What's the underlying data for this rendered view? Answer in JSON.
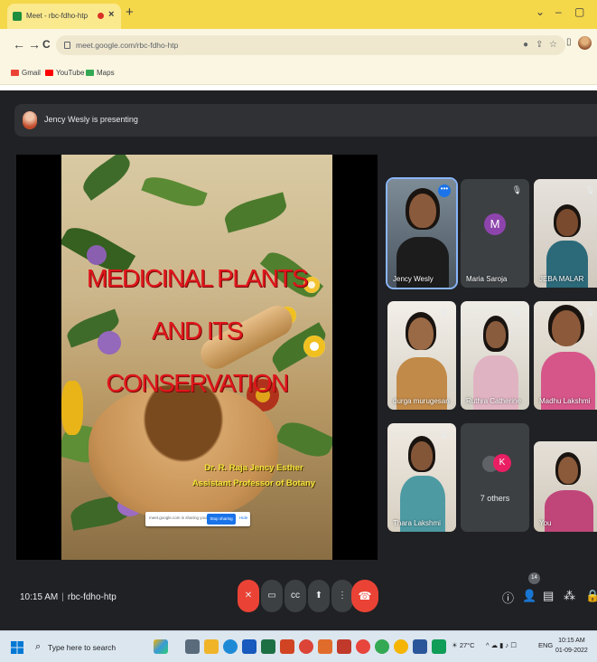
{
  "browser": {
    "tab_title": "Meet - rbc-fdho-htp",
    "tab_close": "×",
    "new_tab": "+",
    "window_controls": [
      "⌄",
      "–",
      "▢"
    ],
    "url": "meet.google.com/rbc-fdho-htp",
    "nav": {
      "back": "←",
      "forward": "→",
      "reload": "C"
    },
    "bookmarks": [
      {
        "label": "Gmail",
        "color": "#ea4335"
      },
      {
        "label": "YouTube",
        "color": "#ff0000"
      },
      {
        "label": "Maps",
        "color": "#34a853"
      }
    ]
  },
  "meet": {
    "presenting_text": "Jency Wesly is presenting",
    "slide": {
      "title_lines": [
        "MEDICINAL PLANTS",
        "AND ITS",
        "CONSERVATION"
      ],
      "author_lines": [
        "Dr. R. Raja Jency Esther",
        "Assistant Professor of Botany"
      ],
      "share_notice": {
        "text": "meet.google.com is sharing your screen.",
        "stop_button": "Stop sharing",
        "hide": "Hide"
      }
    },
    "participants": [
      {
        "name": "Jency Wesly",
        "active": true
      },
      {
        "name": "Maria Saroja",
        "initial": "M",
        "avatar_color": "#8e44ad"
      },
      {
        "name": "JEBA MALAR"
      },
      {
        "name": "durga murugesan"
      },
      {
        "name": "Ruthra Catherine"
      },
      {
        "name": "Madhu Lakshmi"
      },
      {
        "name": "Thara Lakshmi"
      },
      {
        "name": "7 others",
        "initial": "K",
        "avatar_color": "#e91e63"
      },
      {
        "name": "You"
      }
    ],
    "meeting_time": "10:15 AM",
    "meeting_code": "rbc-fdho-htp",
    "participant_count": "14",
    "controls": {
      "end_call_color": "#ea4335",
      "mic_off_color": "#ea4335"
    }
  },
  "taskbar": {
    "search_placeholder": "Type here to search",
    "weather": "27°C",
    "language": "ENG",
    "time": "10:15 AM",
    "date": "01-09-2022"
  }
}
